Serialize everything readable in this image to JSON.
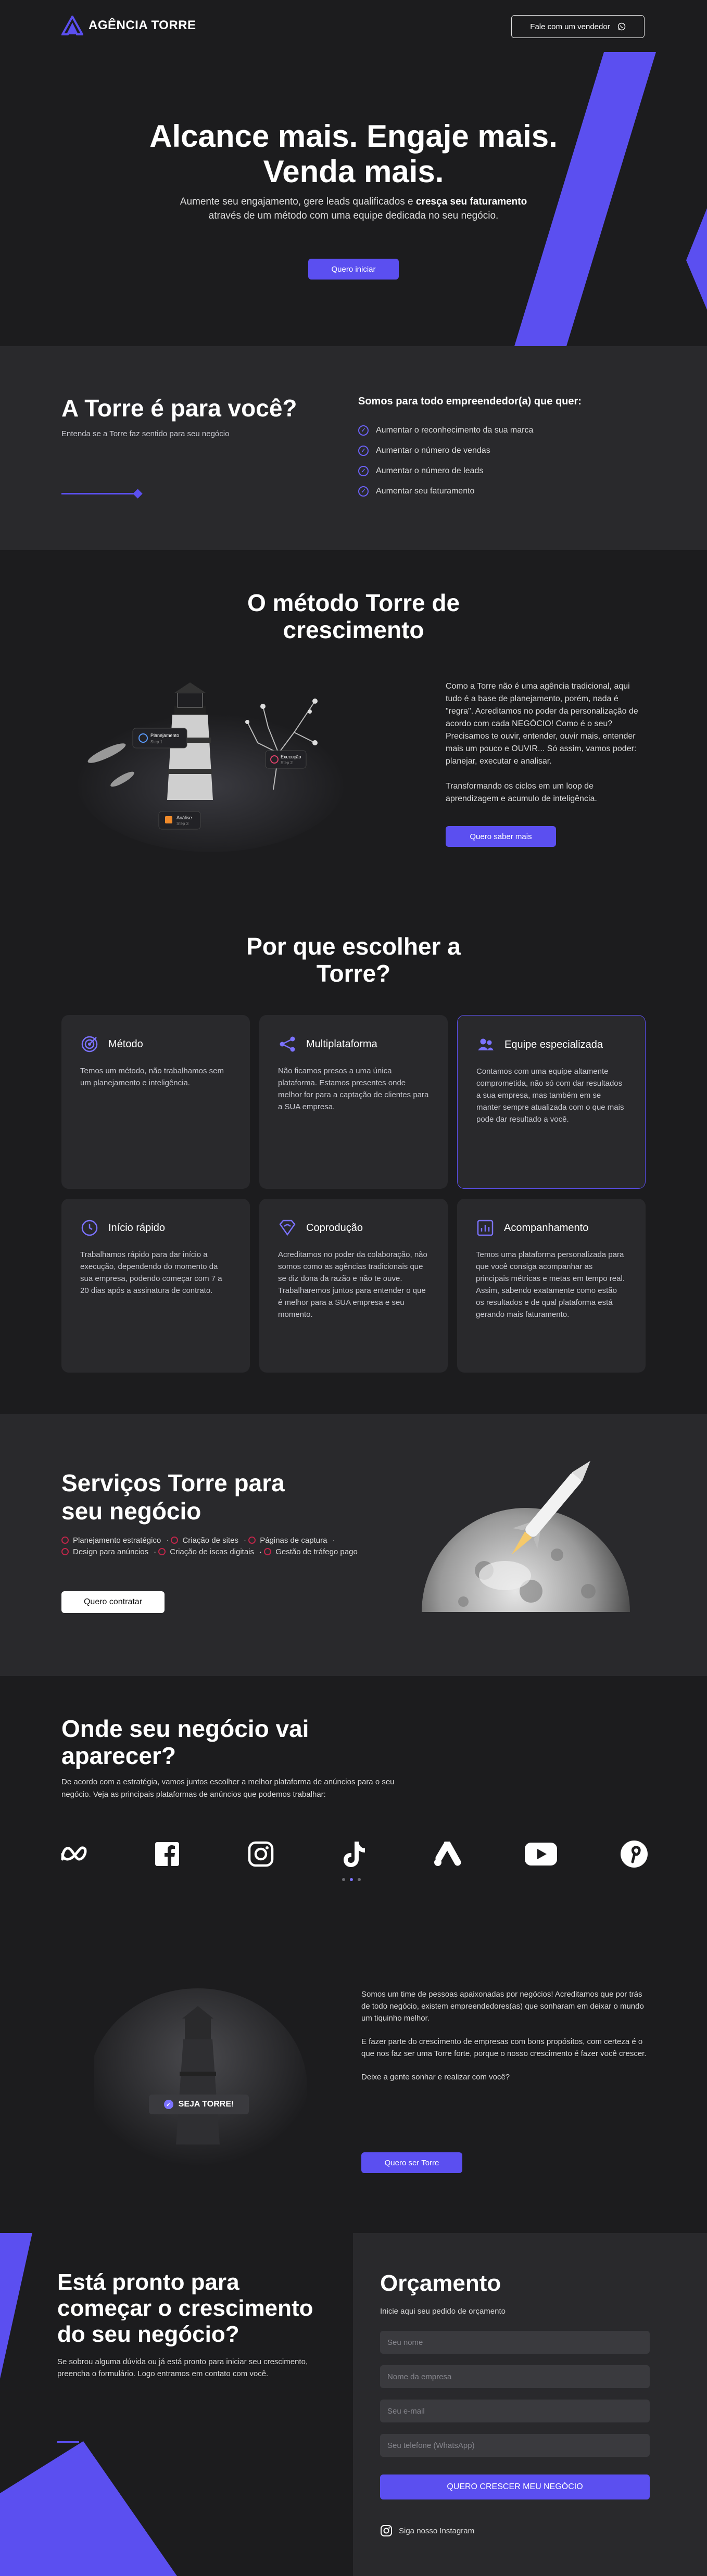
{
  "header": {
    "brand": "AGÊNCIA TORRE",
    "seller_button": "Fale com um vendedor"
  },
  "hero": {
    "title_line1": "Alcance mais. Engaje mais.",
    "title_line2": "Venda mais.",
    "subtitle_a": "Aumente seu engajamento, gere leads qualificados e ",
    "subtitle_b": "cresça seu faturamento",
    "subtitle_c": "através de um método com uma equipe dedicada no seu negócio.",
    "cta": "Quero iniciar"
  },
  "torre": {
    "title": "A Torre é para você?",
    "subtitle": "Entenda se a Torre faz sentido para seu negócio",
    "list_title": "Somos para todo empreendedor(a) que quer:",
    "items": [
      "Aumentar o reconhecimento da sua marca",
      "Aumentar o número de vendas",
      "Aumentar o número de leads",
      "Aumentar seu faturamento"
    ]
  },
  "metodo": {
    "title_line1": "O método Torre de",
    "title_line2": "crescimento",
    "para1": "Como a Torre não é uma agência tradicional, aqui tudo é a base de planejamento, porém, nada é \"regra\". Acreditamos no poder da personalização de acordo com cada NEGÓCIO! Como é o seu? Precisamos te ouvir, entender, ouvir mais, entender mais um pouco e OUVIR... Só assim, vamos poder: planejar, executar e analisar.",
    "para2": "Transformando os ciclos em um loop de aprendizagem e acumulo de inteligência.",
    "cta": "Quero saber mais",
    "tags": [
      {
        "label": "Planejamento",
        "sub": "Step 1"
      },
      {
        "label": "Execução",
        "sub": "Step 2"
      },
      {
        "label": "Análise",
        "sub": "Step 3"
      }
    ]
  },
  "porque": {
    "title_line1": "Por que escolher a",
    "title_line2": "Torre?",
    "cards": [
      {
        "title": "Método",
        "text": "Temos um método, não trabalhamos sem um planejamento e inteligência."
      },
      {
        "title": "Multiplataforma",
        "text": "Não ficamos presos a uma única plataforma. Estamos presentes onde melhor for para a captação de clientes para a SUA empresa."
      },
      {
        "title": "Equipe especializada",
        "text": "Contamos com uma equipe altamente comprometida, não só com dar resultados a sua empresa, mas também em se manter sempre atualizada com o que mais pode dar resultado a você."
      },
      {
        "title": "Início rápido",
        "text": "Trabalhamos rápido para dar início a execução, dependendo do momento da sua empresa, podendo começar com 7 a 20 dias após a assinatura de contrato."
      },
      {
        "title": "Coprodução",
        "text": "Acreditamos no poder da colaboração, não somos como as agências tradicionais que se diz dona da razão e não te ouve. Trabalharemos juntos para entender o que é melhor para a SUA empresa e seu momento."
      },
      {
        "title": "Acompanhamento",
        "text": "Temos uma plataforma personalizada para que você consiga acompanhar as principais métricas e metas em tempo real. Assim, sabendo exatamente como estão os resultados e de qual plataforma está gerando mais faturamento."
      }
    ]
  },
  "servicos": {
    "title_line1": "Serviços Torre para",
    "title_line2": "seu negócio",
    "items": [
      "Planejamento estratégico",
      "Criação de sites",
      "Páginas de captura",
      "Design para anúncios",
      "Criação de iscas digitais",
      "Gestão de tráfego pago"
    ],
    "cta": "Quero contratar"
  },
  "onde": {
    "title_line1": "Onde seu negócio vai",
    "title_line2": "aparecer?",
    "text": "De acordo com a estratégia, vamos juntos escolher a melhor plataforma de anúncios para o seu negócio. Veja as principais plataformas de anúncios que podemos trabalhar:",
    "platforms": [
      "meta-icon",
      "facebook-icon",
      "instagram-icon",
      "tiktok-icon",
      "google-ads-icon",
      "youtube-icon",
      "pinterest-icon"
    ]
  },
  "seja": {
    "para1": "Somos um time de pessoas apaixonadas por negócios! Acreditamos que por trás de todo negócio, existem empreendedores(as) que sonharam em deixar o mundo um tiquinho melhor.",
    "para2": "E fazer parte do crescimento de empresas com bons propósitos, com certeza é o que nos faz ser uma Torre forte, porque o nosso crescimento é fazer você crescer.",
    "para3": "Deixe a gente sonhar e realizar com você?",
    "cta": "Quero ser Torre",
    "badge": "SEJA TORRE!"
  },
  "cta": {
    "title": "Está pronto para começar o crescimento do seu negócio?",
    "text": "Se sobrou alguma dúvida ou já está pronto para iniciar seu crescimento, preencha o formulário. Logo entramos em contato com você."
  },
  "form": {
    "title": "Orçamento",
    "subtitle": "Inicie aqui seu pedido de orçamento",
    "name_placeholder": "Seu nome",
    "company_placeholder": "Nome da empresa",
    "email_placeholder": "Seu e-mail",
    "phone_placeholder": "Seu telefone (WhatsApp)",
    "submit": "QUERO CRESCER MEU NEGÓCIO",
    "instagram": "Siga nosso Instagram"
  },
  "colors": {
    "accent": "#5b4ff0",
    "bg": "#1c1c1e",
    "panel": "#29292c"
  }
}
